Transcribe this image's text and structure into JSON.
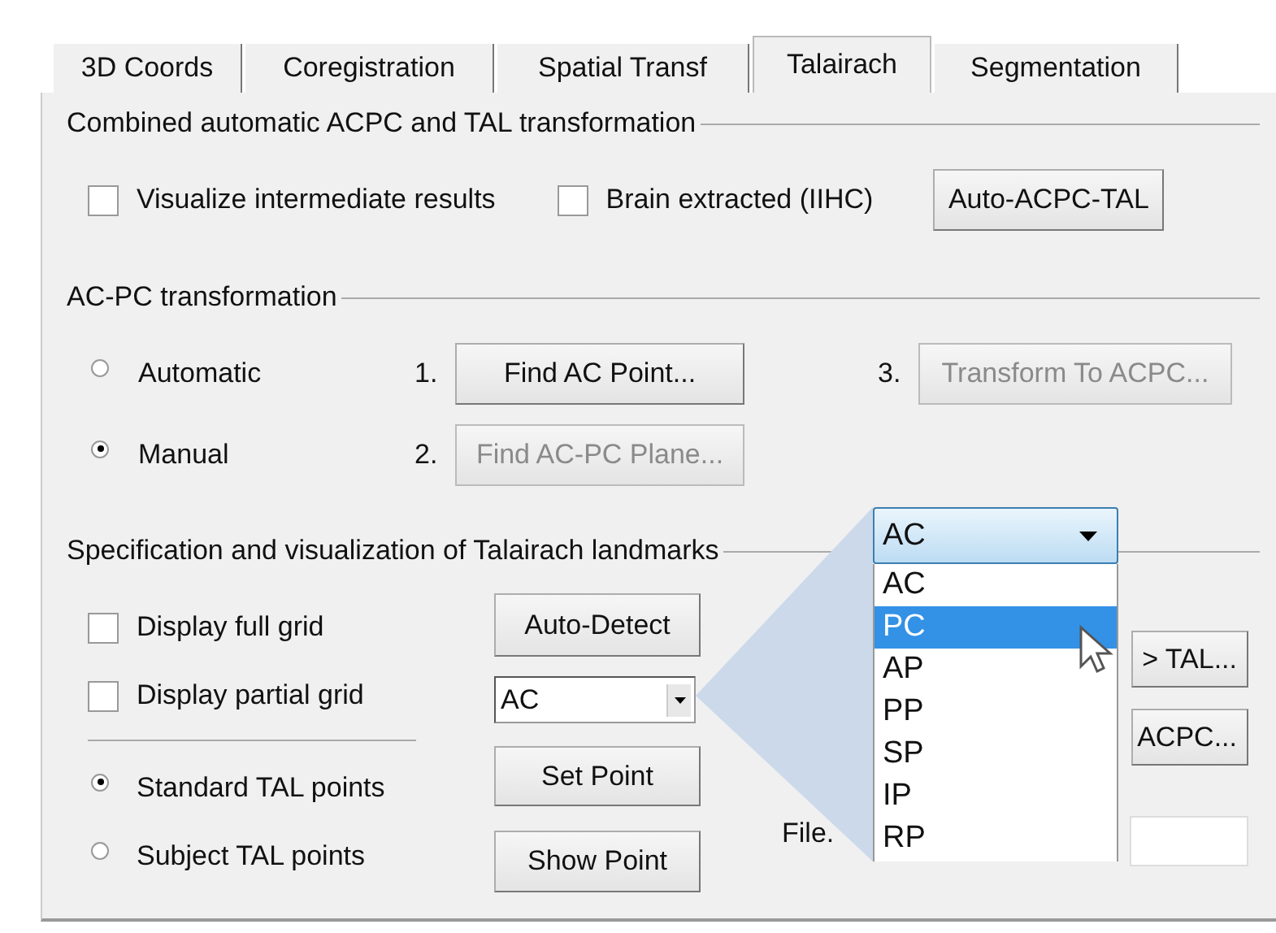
{
  "tabs": [
    {
      "label": "3D Coords",
      "selected": false
    },
    {
      "label": "Coregistration",
      "selected": false
    },
    {
      "label": "Spatial Transf",
      "selected": false
    },
    {
      "label": "Talairach",
      "selected": true
    },
    {
      "label": "Segmentation",
      "selected": false
    }
  ],
  "combined": {
    "title": "Combined automatic ACPC and TAL transformation",
    "options": [
      {
        "label": "Visualize intermediate results",
        "checked": false
      },
      {
        "label": "Brain extracted (IIHC)",
        "checked": false
      }
    ],
    "button": {
      "label": "Auto-ACPC-TAL",
      "disabled": false
    }
  },
  "acpc": {
    "title": "AC-PC transformation",
    "modes": [
      {
        "label": "Automatic",
        "selected": false
      },
      {
        "label": "Manual",
        "selected": true
      }
    ],
    "steps": [
      {
        "number": "1.",
        "label": "Find AC Point...",
        "disabled": false
      },
      {
        "number": "2.",
        "label": "Find AC-PC Plane...",
        "disabled": true
      },
      {
        "number": "3.",
        "label": "Transform To ACPC...",
        "disabled": true
      }
    ]
  },
  "landmarks": {
    "title": "Specification and visualization of Talairach landmarks",
    "grid_options": [
      {
        "label": "Display full grid",
        "checked": false
      },
      {
        "label": "Display partial grid",
        "checked": false
      }
    ],
    "point_sets": [
      {
        "label": "Standard TAL points",
        "selected": true
      },
      {
        "label": "Subject TAL points",
        "selected": false
      }
    ],
    "auto_detect": "Auto-Detect",
    "point_select": {
      "value": "AC"
    },
    "set_point": "Set Point",
    "show_point": "Show Point",
    "right_buttons": [
      "> TAL...",
      "ACPC..."
    ],
    "file_label": "File."
  },
  "zoom_popup": {
    "value": "AC",
    "options": [
      {
        "label": "AC",
        "highlighted": false
      },
      {
        "label": "PC",
        "highlighted": true
      },
      {
        "label": "AP",
        "highlighted": false
      },
      {
        "label": "PP",
        "highlighted": false
      },
      {
        "label": "SP",
        "highlighted": false
      },
      {
        "label": "IP",
        "highlighted": false
      },
      {
        "label": "RP",
        "highlighted": false
      }
    ]
  }
}
